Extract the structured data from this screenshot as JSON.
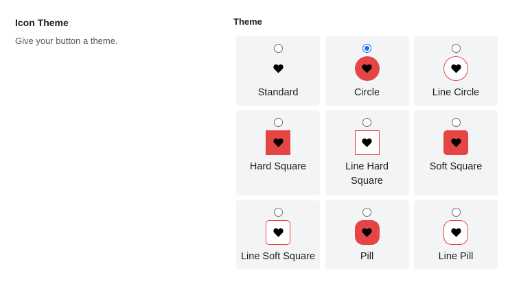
{
  "section": {
    "title": "Icon Theme",
    "description": "Give your button a theme."
  },
  "field": {
    "label": "Theme"
  },
  "accent_color": "#e64545",
  "selected_radio_color": "#1a73e8",
  "themes": [
    {
      "label": "Standard",
      "icon": "heart-icon",
      "selected": false
    },
    {
      "label": "Circle",
      "icon": "heart-icon",
      "selected": true
    },
    {
      "label": "Line Circle",
      "icon": "heart-icon",
      "selected": false
    },
    {
      "label": "Hard Square",
      "icon": "heart-icon",
      "selected": false
    },
    {
      "label": "Line Hard Square",
      "icon": "heart-icon",
      "selected": false
    },
    {
      "label": "Soft Square",
      "icon": "heart-icon",
      "selected": false
    },
    {
      "label": "Line Soft Square",
      "icon": "heart-icon",
      "selected": false
    },
    {
      "label": "Pill",
      "icon": "heart-icon",
      "selected": false
    },
    {
      "label": "Line Pill",
      "icon": "heart-icon",
      "selected": false
    }
  ]
}
